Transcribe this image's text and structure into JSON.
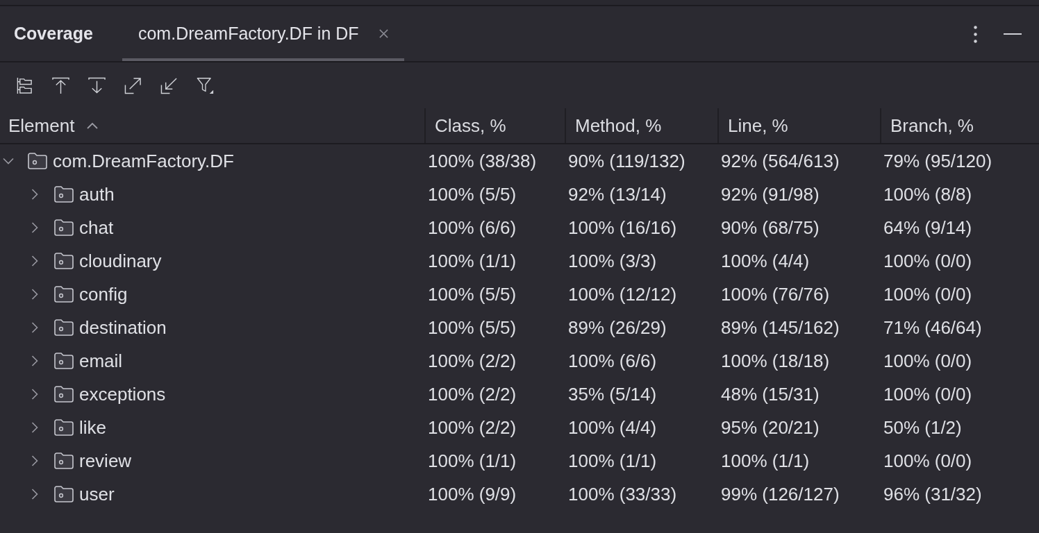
{
  "tool_window": {
    "title": "Coverage"
  },
  "tabs": [
    {
      "label": "com.DreamFactory.DF in DF",
      "selected": true
    }
  ],
  "table": {
    "columns": [
      {
        "label": "Element",
        "sorted": true
      },
      {
        "label": "Class, %",
        "sorted": false
      },
      {
        "label": "Method, %",
        "sorted": false
      },
      {
        "label": "Line, %",
        "sorted": false
      },
      {
        "label": "Branch, %",
        "sorted": false
      }
    ],
    "rows": [
      {
        "expanded": true,
        "cells": [
          "com.DreamFactory.DF",
          "100% (38/38)",
          "90% (119/132)",
          "92% (564/613)",
          "79% (95/120)"
        ],
        "children": [
          {
            "expanded": false,
            "cells": [
              "auth",
              "100% (5/5)",
              "92% (13/14)",
              "92% (91/98)",
              "100% (8/8)"
            ]
          },
          {
            "expanded": false,
            "cells": [
              "chat",
              "100% (6/6)",
              "100% (16/16)",
              "90% (68/75)",
              "64% (9/14)"
            ]
          },
          {
            "expanded": false,
            "cells": [
              "cloudinary",
              "100% (1/1)",
              "100% (3/3)",
              "100% (4/4)",
              "100% (0/0)"
            ]
          },
          {
            "expanded": false,
            "cells": [
              "config",
              "100% (5/5)",
              "100% (12/12)",
              "100% (76/76)",
              "100% (0/0)"
            ]
          },
          {
            "expanded": false,
            "cells": [
              "destination",
              "100% (5/5)",
              "89% (26/29)",
              "89% (145/162)",
              "71% (46/64)"
            ]
          },
          {
            "expanded": false,
            "cells": [
              "email",
              "100% (2/2)",
              "100% (6/6)",
              "100% (18/18)",
              "100% (0/0)"
            ]
          },
          {
            "expanded": false,
            "cells": [
              "exceptions",
              "100% (2/2)",
              "35% (5/14)",
              "48% (15/31)",
              "100% (0/0)"
            ]
          },
          {
            "expanded": false,
            "cells": [
              "like",
              "100% (2/2)",
              "100% (4/4)",
              "95% (20/21)",
              "50% (1/2)"
            ]
          },
          {
            "expanded": false,
            "cells": [
              "review",
              "100% (1/1)",
              "100% (1/1)",
              "100% (1/1)",
              "100% (0/0)"
            ]
          },
          {
            "expanded": false,
            "cells": [
              "user",
              "100% (9/9)",
              "100% (33/33)",
              "99% (126/127)",
              "96% (31/32)"
            ]
          }
        ]
      }
    ]
  }
}
